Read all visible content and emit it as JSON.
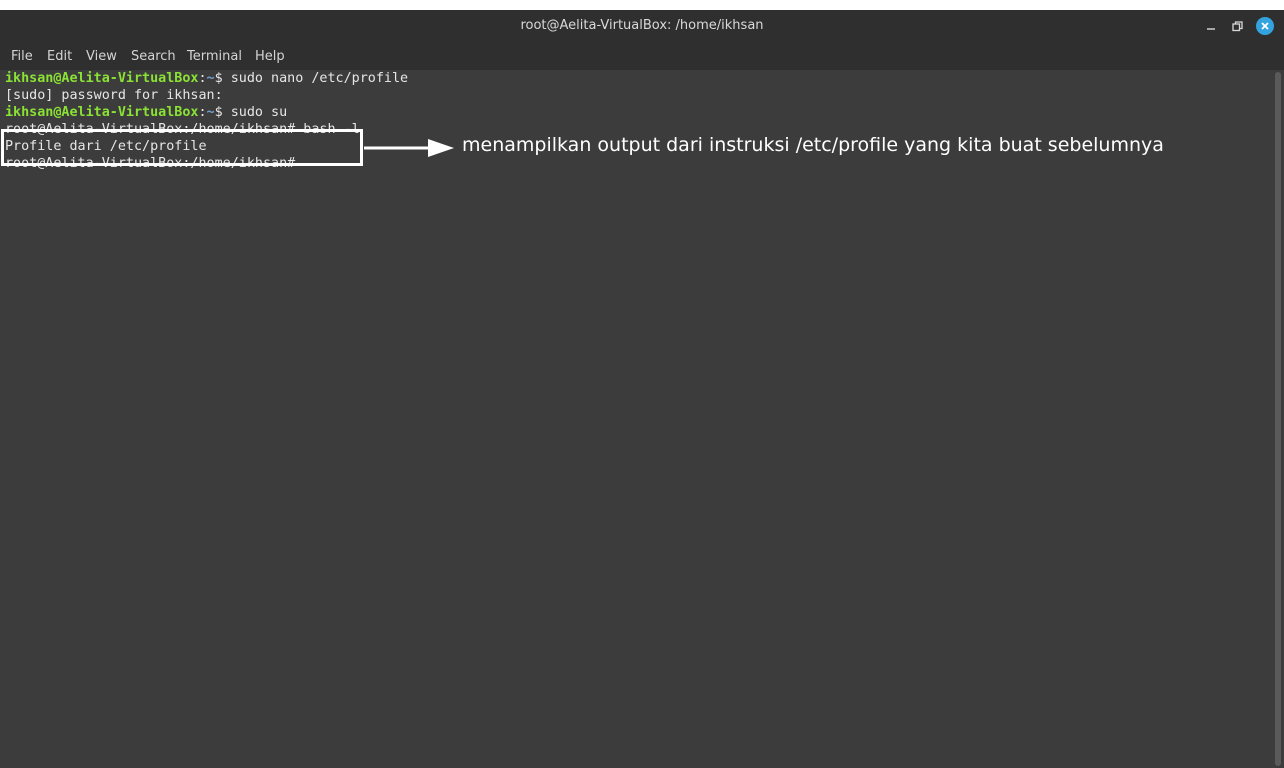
{
  "window": {
    "title": "root@Aelita-VirtualBox: /home/ikhsan"
  },
  "menu": [
    "File",
    "Edit",
    "View",
    "Search",
    "Terminal",
    "Help"
  ],
  "terminal": {
    "lines": [
      {
        "user": "ikhsan@Aelita-VirtualBox",
        "sep": ":",
        "path": "~",
        "rest": "$ sudo nano /etc/profile"
      },
      {
        "text": "[sudo] password for ikhsan:"
      },
      {
        "user": "ikhsan@Aelita-VirtualBox",
        "sep": ":",
        "path": "~",
        "rest": "$ sudo su"
      },
      {
        "text": "root@Aelita-VirtualBox:/home/ikhsan# bash -l"
      },
      {
        "text": "Profile dari /etc/profile"
      },
      {
        "text": "root@Aelita-VirtualBox:/home/ikhsan#"
      }
    ]
  },
  "annotation": {
    "text": "menampilkan output dari instruksi /etc/profile yang kita buat sebelumnya"
  },
  "colors": {
    "background": "#3c3c3c",
    "titlebar": "#2f2f2f",
    "user_prompt": "#8ae234",
    "path_prompt": "#729fcf",
    "close_button": "#33a3e0"
  },
  "icons": [
    "minimize-icon",
    "restore-icon",
    "close-icon"
  ]
}
